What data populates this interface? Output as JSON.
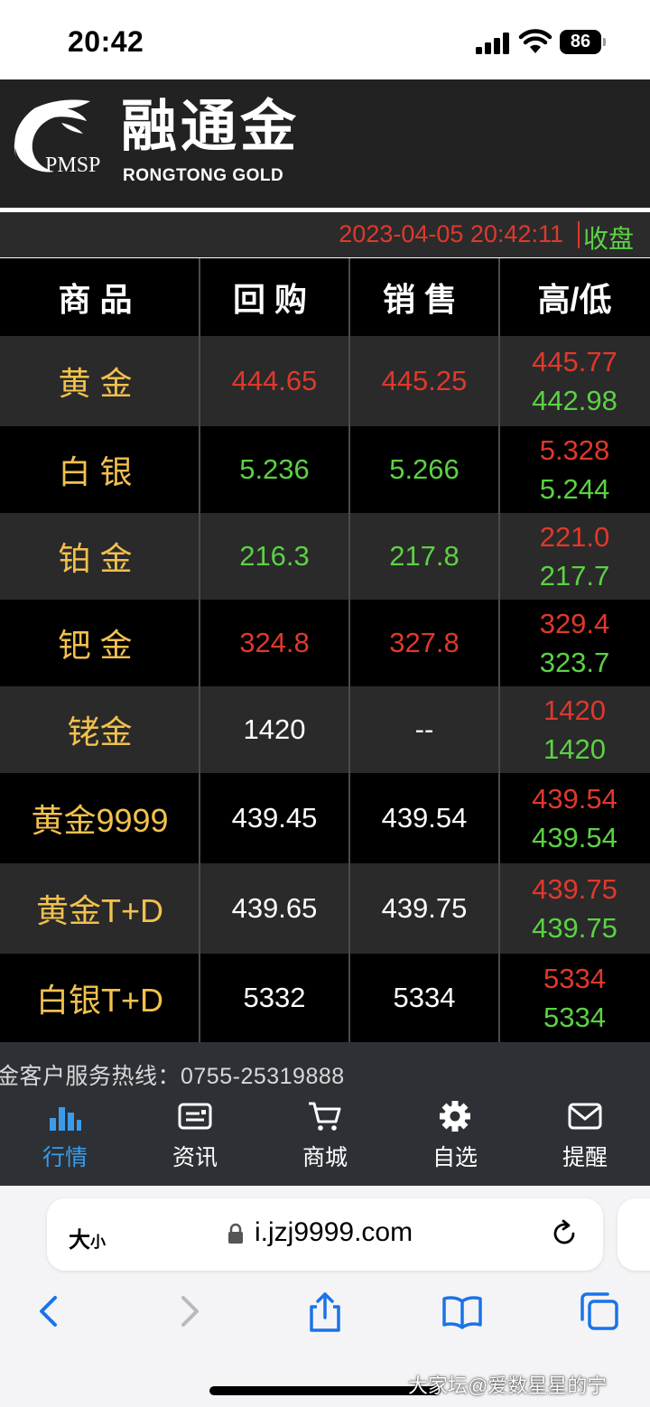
{
  "status_bar": {
    "time": "20:42",
    "battery": "86"
  },
  "header": {
    "logo_text": "PMSP",
    "brand_cn": "融通金",
    "brand_en": "RONGTONG  GOLD"
  },
  "info_row": {
    "datetime": "2023-04-05 20:42:11",
    "market_status": "收盘"
  },
  "table": {
    "columns": [
      "商品",
      "回购",
      "销售",
      "高/低"
    ],
    "rows": [
      {
        "name": "黄金",
        "buy": "444.65",
        "sell": "445.25",
        "high": "445.77",
        "low": "442.98"
      },
      {
        "name": "白银",
        "buy": "5.236",
        "sell": "5.266",
        "high": "5.328",
        "low": "5.244"
      },
      {
        "name": "铂金",
        "buy": "216.3",
        "sell": "217.8",
        "high": "221.0",
        "low": "217.7"
      },
      {
        "name": "钯金",
        "buy": "324.8",
        "sell": "327.8",
        "high": "329.4",
        "low": "323.7"
      },
      {
        "name": "铑金",
        "buy": "1420",
        "sell": "--",
        "high": "1420",
        "low": "1420"
      },
      {
        "name": "黄金9999",
        "buy": "439.45",
        "sell": "439.54",
        "high": "439.54",
        "low": "439.54"
      },
      {
        "name": "黄金T+D",
        "buy": "439.65",
        "sell": "439.75",
        "high": "439.75",
        "low": "439.75"
      },
      {
        "name": "白银T+D",
        "buy": "5332",
        "sell": "5334",
        "high": "5334",
        "low": "5334"
      }
    ]
  },
  "hotline": "金客户服务热线：0755-25319888",
  "tabs": [
    {
      "label": "行情",
      "icon": "bar-chart-icon",
      "active": true
    },
    {
      "label": "资讯",
      "icon": "news-card-icon",
      "active": false
    },
    {
      "label": "商城",
      "icon": "cart-icon",
      "active": false
    },
    {
      "label": "自选",
      "icon": "gear-icon",
      "active": false
    },
    {
      "label": "提醒",
      "icon": "mail-icon",
      "active": false
    }
  ],
  "browser": {
    "text_size_label": "大",
    "text_size_small": "小",
    "url": "i.jzj9999.com"
  },
  "watermark": "大家坛@爱数星星的宁",
  "colors": {
    "up": "#e0382c",
    "down": "#5bd243",
    "name": "#f2c14e",
    "accent": "#3c9be8"
  }
}
